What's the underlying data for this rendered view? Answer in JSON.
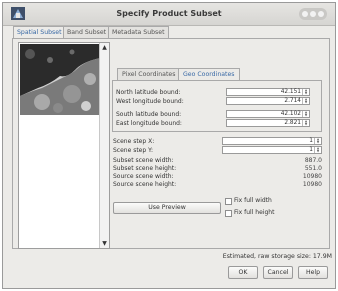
{
  "window": {
    "title": "Specify Product Subset"
  },
  "tabs": [
    {
      "label": "Spatial Subset",
      "active": true
    },
    {
      "label": "Band Subset",
      "active": false
    },
    {
      "label": "Metadata Subset",
      "active": false
    }
  ],
  "subtabs": [
    {
      "label": "Pixel Coordinates",
      "active": false
    },
    {
      "label": "Geo Coordinates",
      "active": true
    }
  ],
  "geo": {
    "north_label": "North latitude bound:",
    "north_value": "42.151",
    "west_label": "West longitude bound:",
    "west_value": "2.714",
    "south_label": "South latitude bound:",
    "south_value": "42.102",
    "east_label": "East longitude bound:",
    "east_value": "2.821"
  },
  "scene": {
    "step_x_label": "Scene step X:",
    "step_x_value": "1",
    "step_y_label": "Scene step Y:",
    "step_y_value": "1",
    "subset_width_label": "Subset scene width:",
    "subset_width_value": "887.0",
    "subset_height_label": "Subset scene height:",
    "subset_height_value": "551.0",
    "source_width_label": "Source scene width:",
    "source_width_value": "10980",
    "source_height_label": "Source scene height:",
    "source_height_value": "10980"
  },
  "buttons": {
    "use_preview": "Use Preview",
    "ok": "OK",
    "cancel": "Cancel",
    "help": "Help"
  },
  "checkboxes": {
    "fix_full_width": "Fix full width",
    "fix_full_height": "Fix full height"
  },
  "status": {
    "storage": "Estimated, raw storage size: 17.9M"
  },
  "colors": {
    "accent_tab": "#3a6aa6",
    "window_bg": "#ecebe8"
  }
}
